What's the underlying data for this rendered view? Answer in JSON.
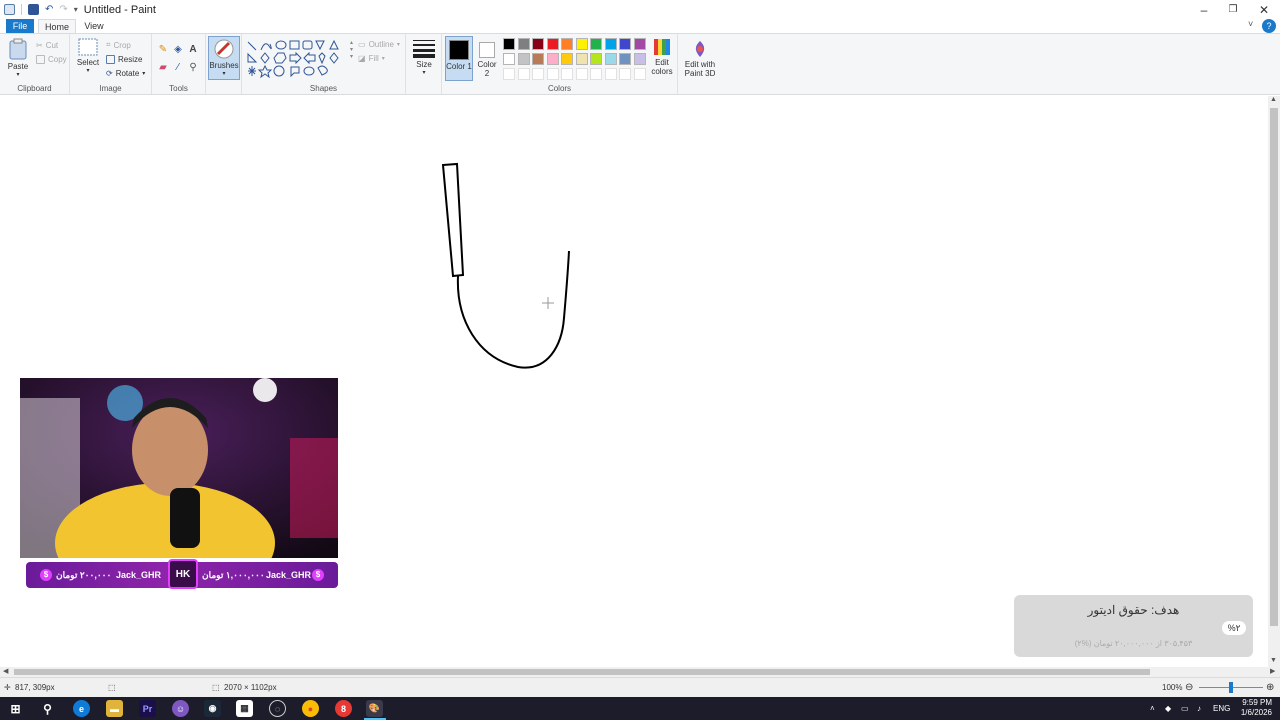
{
  "window": {
    "title": "Untitled - Paint"
  },
  "tabs": {
    "file": "File",
    "home": "Home",
    "view": "View"
  },
  "clipboard": {
    "paste": "Paste",
    "cut": "Cut",
    "copy": "Copy",
    "label": "Clipboard"
  },
  "image": {
    "select": "Select",
    "crop": "Crop",
    "resize": "Resize",
    "rotate": "Rotate",
    "label": "Image"
  },
  "tools": {
    "label": "Tools",
    "text_tool_glyph": "A"
  },
  "brushes": {
    "label": "Brushes"
  },
  "shapes": {
    "outline": "Outline",
    "fill": "Fill",
    "label": "Shapes"
  },
  "size": {
    "label": "Size"
  },
  "colors": {
    "color1": "Color 1",
    "color2": "Color 2",
    "edit_colors": "Edit colors",
    "edit_paint3d": "Edit with Paint 3D",
    "label": "Colors",
    "color1_value": "#000000",
    "color2_value": "#ffffff",
    "palette_row1": [
      "#000000",
      "#7f7f7f",
      "#880015",
      "#ed1c24",
      "#ff7f27",
      "#fff200",
      "#22b14c",
      "#00a2e8",
      "#3f48cc",
      "#a349a4"
    ],
    "palette_row2": [
      "#ffffff",
      "#c3c3c3",
      "#b97a57",
      "#ffaec9",
      "#ffc90e",
      "#efe4b0",
      "#b5e61d",
      "#99d9ea",
      "#7092be",
      "#c8bfe7"
    ]
  },
  "status": {
    "cursor_pos": "817, 309px",
    "canvas_size": "2070 × 1102px",
    "zoom": "100%",
    "zoom_fraction": 0.5
  },
  "stream": {
    "donation_left_amount": "۲۰۰,۰۰۰ تومان",
    "donation_left_name": "Jack_GHR",
    "badge": "HK",
    "donation_right_amount": "۱,۰۰۰,۰۰۰ تومان",
    "donation_right_name": "Jack_GHR",
    "goal_title": "هدف: حقوق ادیتور",
    "goal_percent": "%۲",
    "goal_progress": "۳۰۵,۴۵۳ از ۲۰,۰۰۰,۰۰۰ تومان (%۲)"
  },
  "taskbar": {
    "language": "ENG",
    "time": "9:59 PM",
    "date": "1/6/2026"
  }
}
